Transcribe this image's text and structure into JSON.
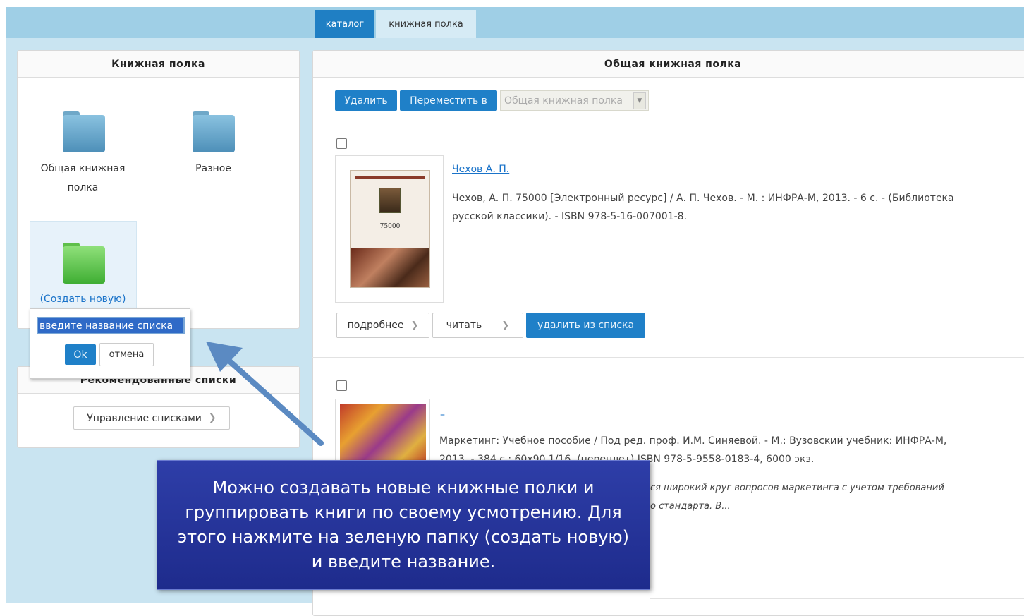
{
  "tabs": {
    "catalog": "каталог",
    "bookshelf": "книжная полка"
  },
  "left_panel": {
    "title": "Книжная полка",
    "folders": [
      {
        "label": "Общая книжная полка",
        "line1": "Общая книжная",
        "line2": "полка",
        "color": "#5a9cc4"
      },
      {
        "label": "Разное",
        "color": "#5a9cc4"
      },
      {
        "label": "(Создать новую)",
        "color": "#4fbf3f"
      }
    ],
    "popup": {
      "input_value": "введите название списка",
      "ok": "Ok",
      "cancel": "отмена"
    }
  },
  "recommended": {
    "title": "Рекомендованные списки",
    "manage_button": "Управление списками"
  },
  "main": {
    "title": "Общая книжная полка",
    "toolbar": {
      "delete": "Удалить",
      "move_to": "Переместить в",
      "select_value": "Общая книжная полка"
    },
    "books": [
      {
        "author_link": "Чехов А. П.",
        "description_line1": "Чехов, А. П. 75000 [Электронный ресурс] / А. П. Чехов. - М. : ИНФРА-М, 2013. - 6 с. - (Библиотека",
        "description_line2": "русской классики). - ISBN 978-5-16-007001-8.",
        "cover_text": "75000",
        "actions": {
          "details": "подробнее",
          "read": "читать",
          "remove": "удалить из списка"
        }
      },
      {
        "author_link": "–",
        "description_line1": "Маркетинг: Учебное пособие / Под ред. проф. И.М. Синяевой. - М.: Вузовский учебник: ИНФРА-М,",
        "description_line2": "2013. - 384 с.: 60х90 1/16. (переплет) ISBN 978-5-9558-0183-4, 6000 экз.",
        "annotation_line1": "ся широкий круг вопросов маркетинга с учетом требований",
        "annotation_line2": "о стандарта. В..."
      }
    ]
  },
  "callout": {
    "line1": "Можно создавать новые книжные полки и",
    "line2": "группировать книги по своему усмотрению. Для",
    "line3": "этого нажмите на зеленую папку (создать новую)",
    "line4": "и введите название."
  },
  "colors": {
    "accent": "#1f80c8",
    "topbar": "#9fcfe6",
    "background": "#c9e4f1",
    "callout": "#25339a"
  }
}
